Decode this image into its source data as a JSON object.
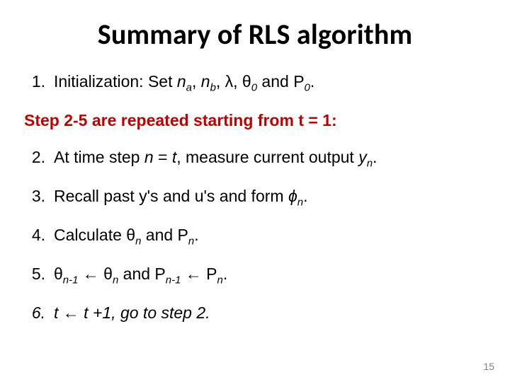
{
  "title": "Summary of RLS algorithm",
  "steps": {
    "s1_num": "1.",
    "s1": "Initialization: Set <span class=\"emph\">n<sub>a</sub></span>, <span class=\"emph\">n<sub>b</sub></span>, λ, θ<sub>0</sub> and P<sub>0</sub>.",
    "note": "Step 2-5 are repeated starting from t = 1:",
    "s2_num": "2.",
    "s2": "At time step <span class=\"emph\">n</span> = <span class=\"emph\">t</span>, measure current output <span class=\"emph\">y<sub>n</sub></span>.",
    "s3_num": "3.",
    "s3": "Recall past y's and u's and form <span class=\"emph\">ϕ<sub>n</sub></span>.",
    "s4_num": "4.",
    "s4": "Calculate θ<span class=\"emph\"><sub>n</sub></span> and P<span class=\"emph\"><sub>n</sub></span>.",
    "s5_num": "5.",
    "s5": "θ<span class=\"emph\"><sub>n-1</sub></span> <span class=\"arrow\">←</span> θ<span class=\"emph\"><sub>n</sub></span> and P<span class=\"emph\"><sub>n-1</sub></span> <span class=\"arrow\">←</span> P<span class=\"emph\"><sub>n</sub></span>.",
    "s6_num": "6.",
    "s6": "<span class=\"emph\">t</span> <span class=\"arrow\">←</span> <span class=\"emph\">t</span> +1, go to step 2."
  },
  "page_number": "15"
}
